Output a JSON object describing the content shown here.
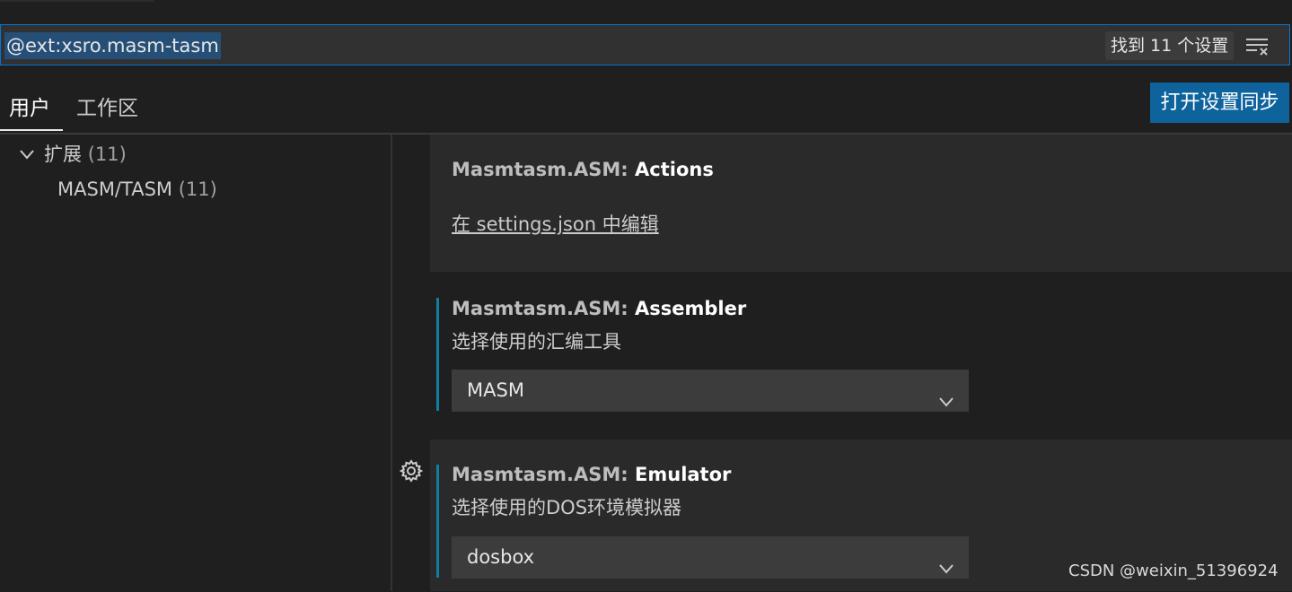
{
  "search": {
    "value": "@ext:xsro.masm-tasm",
    "result_count": "找到 11 个设置"
  },
  "tabs": {
    "user": "用户",
    "workspace": "工作区"
  },
  "sync_button": "打开设置同步",
  "tree": {
    "extensions_label": "扩展",
    "extensions_count": "(11)",
    "masm_label": "MASM/TASM",
    "masm_count": "(11)"
  },
  "settings": [
    {
      "prefix": "Masmtasm.ASM: ",
      "key": "Actions",
      "link": "在 settings.json 中编辑"
    },
    {
      "prefix": "Masmtasm.ASM: ",
      "key": "Assembler",
      "description": "选择使用的汇编工具",
      "value": "MASM"
    },
    {
      "prefix": "Masmtasm.ASM: ",
      "key": "Emulator",
      "description": "选择使用的DOS环境模拟器",
      "value": "dosbox"
    }
  ],
  "watermark": "CSDN @weixin_51396924",
  "colors": {
    "accent": "#0e639c",
    "focus_border": "#0078d4",
    "modified_indicator": "#0e7fa3"
  },
  "icons": {
    "filter": "clear-filter-icon",
    "chevron": "chevron-down-icon",
    "gear": "gear-icon"
  }
}
